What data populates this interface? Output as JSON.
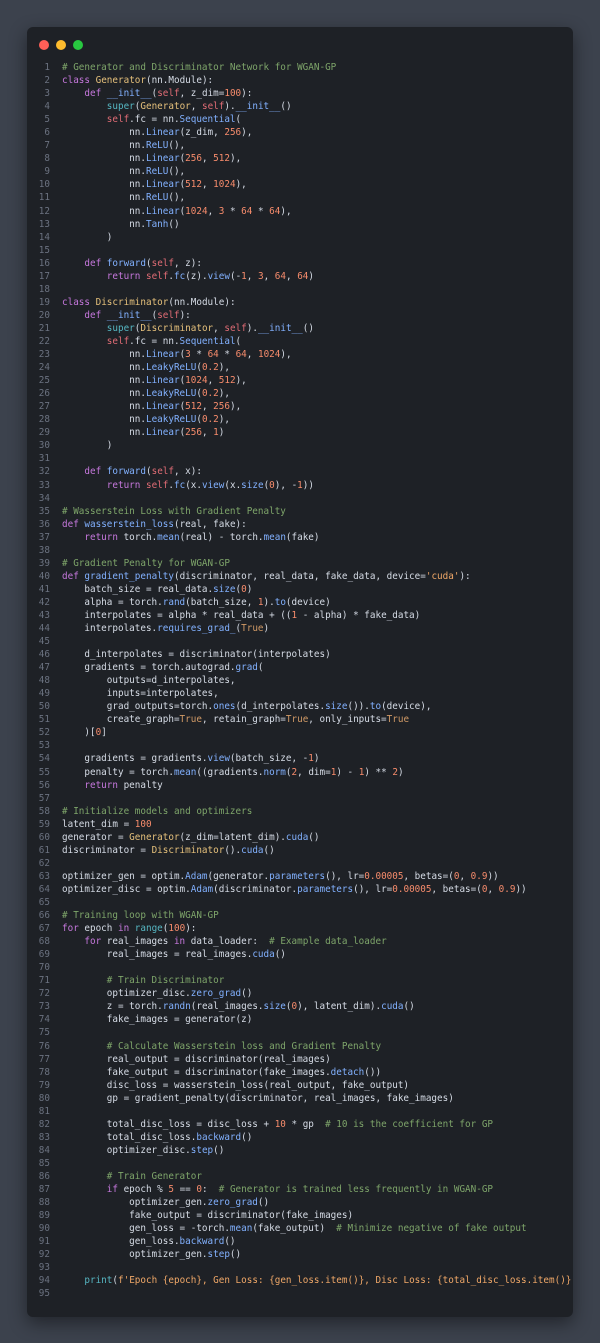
{
  "window": {
    "controls": [
      "close",
      "minimize",
      "maximize"
    ],
    "colors": {
      "close": "#ff5f57",
      "minimize": "#febc2e",
      "maximize": "#28c840",
      "background": "#1e2126",
      "page": "#3c424d"
    }
  },
  "code": {
    "language": "python",
    "lines": [
      "# Generator and Discriminator Network for WGAN-GP",
      "class Generator(nn.Module):",
      "    def __init__(self, z_dim=100):",
      "        super(Generator, self).__init__()",
      "        self.fc = nn.Sequential(",
      "            nn.Linear(z_dim, 256),",
      "            nn.ReLU(),",
      "            nn.Linear(256, 512),",
      "            nn.ReLU(),",
      "            nn.Linear(512, 1024),",
      "            nn.ReLU(),",
      "            nn.Linear(1024, 3 * 64 * 64),",
      "            nn.Tanh()",
      "        )",
      "",
      "    def forward(self, z):",
      "        return self.fc(z).view(-1, 3, 64, 64)",
      "",
      "class Discriminator(nn.Module):",
      "    def __init__(self):",
      "        super(Discriminator, self).__init__()",
      "        self.fc = nn.Sequential(",
      "            nn.Linear(3 * 64 * 64, 1024),",
      "            nn.LeakyReLU(0.2),",
      "            nn.Linear(1024, 512),",
      "            nn.LeakyReLU(0.2),",
      "            nn.Linear(512, 256),",
      "            nn.LeakyReLU(0.2),",
      "            nn.Linear(256, 1)",
      "        )",
      "",
      "    def forward(self, x):",
      "        return self.fc(x.view(x.size(0), -1))",
      "",
      "# Wasserstein Loss with Gradient Penalty",
      "def wasserstein_loss(real, fake):",
      "    return torch.mean(real) - torch.mean(fake)",
      "",
      "# Gradient Penalty for WGAN-GP",
      "def gradient_penalty(discriminator, real_data, fake_data, device='cuda'):",
      "    batch_size = real_data.size(0)",
      "    alpha = torch.rand(batch_size, 1).to(device)",
      "    interpolates = alpha * real_data + ((1 - alpha) * fake_data)",
      "    interpolates.requires_grad_(True)",
      "",
      "    d_interpolates = discriminator(interpolates)",
      "    gradients = torch.autograd.grad(",
      "        outputs=d_interpolates,",
      "        inputs=interpolates,",
      "        grad_outputs=torch.ones(d_interpolates.size()).to(device),",
      "        create_graph=True, retain_graph=True, only_inputs=True",
      "    )[0]",
      "",
      "    gradients = gradients.view(batch_size, -1)",
      "    penalty = torch.mean((gradients.norm(2, dim=1) - 1) ** 2)",
      "    return penalty",
      "",
      "# Initialize models and optimizers",
      "latent_dim = 100",
      "generator = Generator(z_dim=latent_dim).cuda()",
      "discriminator = Discriminator().cuda()",
      "",
      "optimizer_gen = optim.Adam(generator.parameters(), lr=0.00005, betas=(0, 0.9))",
      "optimizer_disc = optim.Adam(discriminator.parameters(), lr=0.00005, betas=(0, 0.9))",
      "",
      "# Training loop with WGAN-GP",
      "for epoch in range(100):",
      "    for real_images in data_loader:  # Example data_loader",
      "        real_images = real_images.cuda()",
      "",
      "        # Train Discriminator",
      "        optimizer_disc.zero_grad()",
      "        z = torch.randn(real_images.size(0), latent_dim).cuda()",
      "        fake_images = generator(z)",
      "",
      "        # Calculate Wasserstein loss and Gradient Penalty",
      "        real_output = discriminator(real_images)",
      "        fake_output = discriminator(fake_images.detach())",
      "        disc_loss = wasserstein_loss(real_output, fake_output)",
      "        gp = gradient_penalty(discriminator, real_images, fake_images)",
      "",
      "        total_disc_loss = disc_loss + 10 * gp  # 10 is the coefficient for GP",
      "        total_disc_loss.backward()",
      "        optimizer_disc.step()",
      "",
      "        # Train Generator",
      "        if epoch % 5 == 0:  # Generator is trained less frequently in WGAN-GP",
      "            optimizer_gen.zero_grad()",
      "            fake_output = discriminator(fake_images)",
      "            gen_loss = -torch.mean(fake_output)  # Minimize negative of fake output",
      "            gen_loss.backward()",
      "            optimizer_gen.step()",
      "",
      "    print(f'Epoch {epoch}, Gen Loss: {gen_loss.item()}, Disc Loss: {total_disc_loss.item()}')",
      ""
    ]
  }
}
